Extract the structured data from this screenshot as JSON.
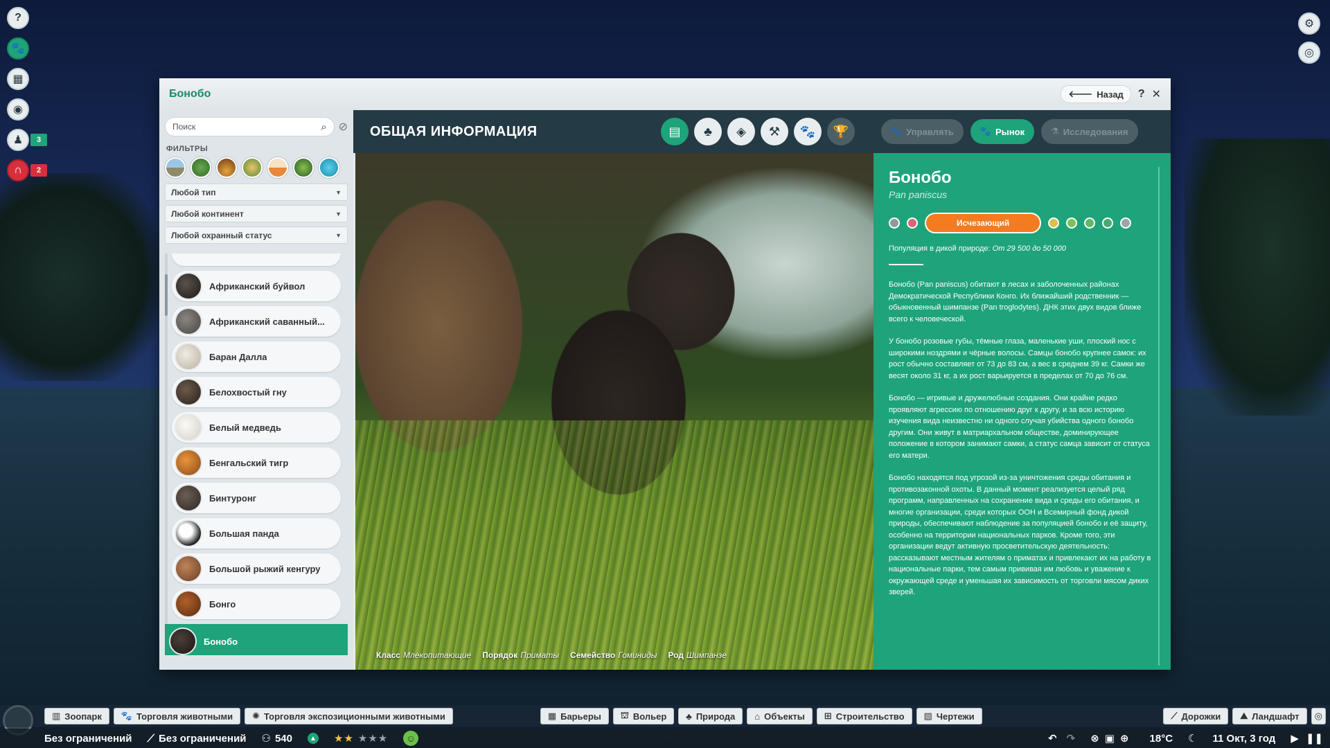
{
  "window": {
    "title": "Бонобо",
    "back_label": "Назад",
    "help_label": "?",
    "close_label": "✕"
  },
  "hud_left": {
    "badge_staff": "3",
    "badge_guests": "2"
  },
  "sidebar": {
    "search_placeholder": "Поиск",
    "filters_label": "ФИЛЬТРЫ",
    "dropdowns": [
      "Любой тип",
      "Любой континент",
      "Любой охранный статус"
    ],
    "animals": [
      "Африканский буйвол",
      "Африканский саванный...",
      "Баран Далла",
      "Белохвостый гну",
      "Белый медведь",
      "Бенгальский тигр",
      "Бинтуронг",
      "Большая панда",
      "Большой рыжий кенгуру",
      "Бонго",
      "Бонобо"
    ],
    "selected_index": 10
  },
  "header": {
    "title": "ОБЩАЯ ИНФОРМАЦИЯ",
    "pills": {
      "manage": "Управлять",
      "market": "Рынок",
      "research": "Исследования"
    }
  },
  "taxonomy": {
    "class_k": "Класс",
    "class_v": "Млекопитающие",
    "order_k": "Порядок",
    "order_v": "Приматы",
    "family_k": "Семейство",
    "family_v": "Гоминиды",
    "genus_k": "Род",
    "genus_v": "Шимпанзе"
  },
  "info": {
    "name": "Бонобо",
    "scientific": "Pan paniscus",
    "status": "Исчезающий",
    "status_colors": [
      "#8f9aa0",
      "#d8657a",
      "#f47b20",
      "#d8c24a",
      "#7cc25a",
      "#5fb86a",
      "#4aa872",
      "#9aa6ac"
    ],
    "population_label": "Популяция в дикой природе:",
    "population_value": "От 29 500 до 50 000",
    "paragraphs": [
      "Бонобо (Pan paniscus) обитают в лесах и заболоченных районах Демократической Республики Конго. Их ближайший родственник — обыкновенный шимпанзе (Pan troglodytes). ДНК этих двух видов ближе всего к человеческой.",
      "У бонобо розовые губы, тёмные глаза, маленькие уши, плоский нос с широкими ноздрями и чёрные волосы. Самцы бонобо крупнее самок: их рост обычно составляет от 73 до 83 см, а вес в среднем 39 кг. Самки же весят около 31 кг, а их рост варьируется в пределах от 70 до 76 см.",
      "Бонобо — игривые и дружелюбные создания. Они крайне редко проявляют агрессию по отношению друг к другу, и за всю историю изучения вида неизвестно ни одного случая убийства одного бонобо другим. Они живут в матриархальном обществе, доминирующее положение в котором занимают самки, а статус самца зависит от статуса его матери.",
      "Бонобо находятся под угрозой из-за уничтожения среды обитания и противозаконной охоты. В данный момент реализуется целый ряд программ, направленных на сохранение вида и среды его обитания, и многие организации, среди которых ООН и Всемирный фонд дикой природы, обеспечивают наблюдение за популяцией бонобо и её защиту, особенно на территории национальных парков. Кроме того, эти организации ведут активную просветительскую деятельность: рассказывают местным жителям о приматах и привлекают их на работу в национальные парки, тем самым прививая им любовь и уважение к окружающей среде и уменьшая их зависимость от торговли мясом диких зверей."
    ]
  },
  "bottom_bar": {
    "left_buttons": [
      "Зоопарк",
      "Торговля животными",
      "Торговля экспозиционными животными"
    ],
    "center_buttons": [
      "Барьеры",
      "Вольер",
      "Природа",
      "Объекты",
      "Строительство",
      "Чертежи"
    ],
    "right_buttons": [
      "Дорожки",
      "Ландшафт"
    ]
  },
  "status_bar": {
    "money": "Без ограничений",
    "research": "Без ограничений",
    "guests": "540",
    "rating_stars": 2,
    "rating_max": 5,
    "temperature": "18°C",
    "date": "11 Окт, 3 год"
  }
}
